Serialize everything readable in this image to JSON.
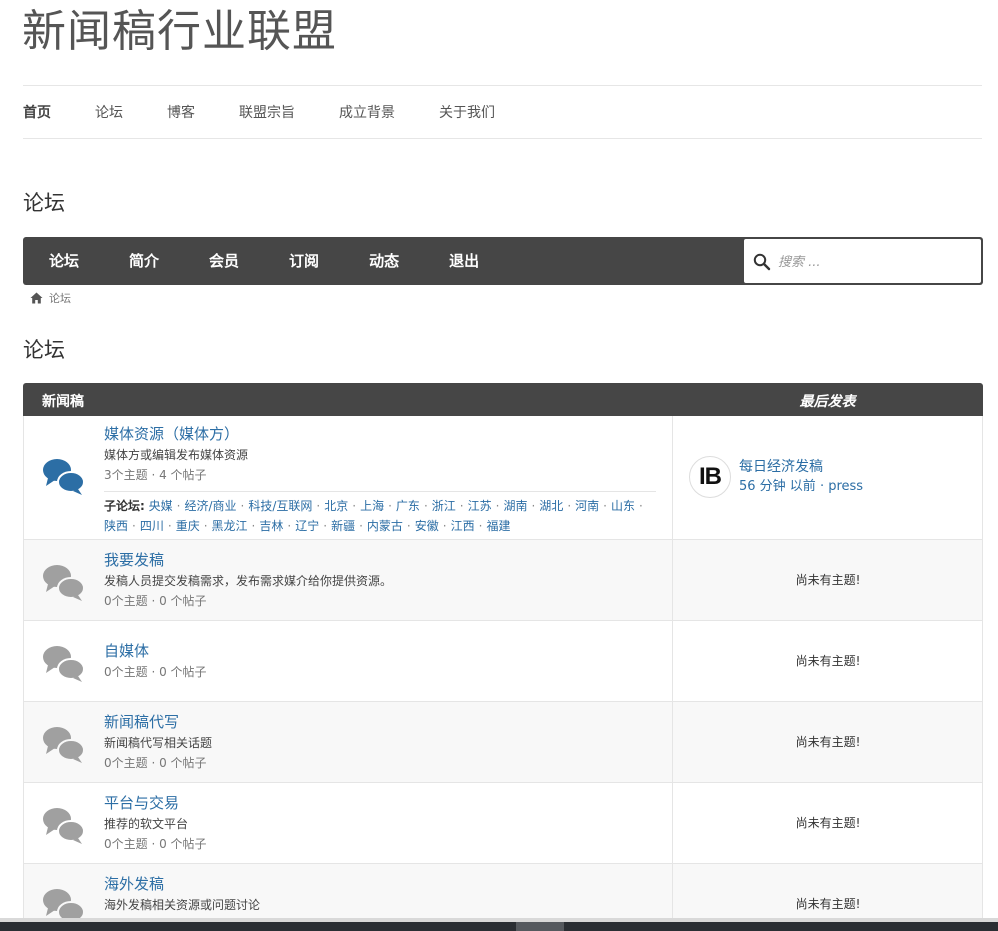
{
  "site": {
    "title": "新闻稿行业联盟"
  },
  "main_nav": [
    {
      "label": "首页",
      "active": true
    },
    {
      "label": "论坛",
      "active": false
    },
    {
      "label": "博客",
      "active": false
    },
    {
      "label": "联盟宗旨",
      "active": false
    },
    {
      "label": "成立背景",
      "active": false
    },
    {
      "label": "关于我们",
      "active": false
    }
  ],
  "page_title": "论坛",
  "forum_nav": {
    "tabs": [
      "论坛",
      "简介",
      "会员",
      "订阅",
      "动态",
      "退出"
    ],
    "search_placeholder": "搜索 ..."
  },
  "breadcrumb": {
    "label": "论坛"
  },
  "section_title": "论坛",
  "table": {
    "header_forum": "新闻稿",
    "header_last": "最后发表",
    "rows": [
      {
        "name": "媒体资源（媒体方）",
        "desc": "媒体方或编辑发布媒体资源",
        "stats": "3个主题 · 4 个帖子",
        "icon_color": "#2c6ea5",
        "sub_label": "子论坛:",
        "subforums": [
          "央媒",
          "经济/商业",
          "科技/互联网",
          "北京",
          "上海",
          "广东",
          "浙江",
          "江苏",
          "湖南",
          "湖北",
          "河南",
          "山东",
          "陕西",
          "四川",
          "重庆",
          "黑龙江",
          "吉林",
          "辽宁",
          "新疆",
          "内蒙古",
          "安徽",
          "江西",
          "福建"
        ],
        "last": {
          "avatar": "IB",
          "title": "每日经济发稿",
          "time": "56 分钟 以前",
          "author": "press"
        }
      },
      {
        "name": "我要发稿",
        "desc": "发稿人员提交发稿需求，发布需求媒介给你提供资源。",
        "stats": "0个主题 · 0 个帖子",
        "icon_color": "#a0a0a0",
        "no_topic": "尚未有主题!"
      },
      {
        "name": "自媒体",
        "desc": "",
        "stats": "0个主题 · 0 个帖子",
        "icon_color": "#a0a0a0",
        "no_topic": "尚未有主题!"
      },
      {
        "name": "新闻稿代写",
        "desc": "新闻稿代写相关话题",
        "stats": "0个主题 · 0 个帖子",
        "icon_color": "#a0a0a0",
        "no_topic": "尚未有主题!"
      },
      {
        "name": "平台与交易",
        "desc": "推荐的软文平台",
        "stats": "0个主题 · 0 个帖子",
        "icon_color": "#a0a0a0",
        "no_topic": "尚未有主题!"
      },
      {
        "name": "海外发稿",
        "desc": "海外发稿相关资源或问题讨论",
        "stats": "",
        "icon_color": "#a0a0a0",
        "no_topic": "尚未有主题!"
      }
    ]
  }
}
